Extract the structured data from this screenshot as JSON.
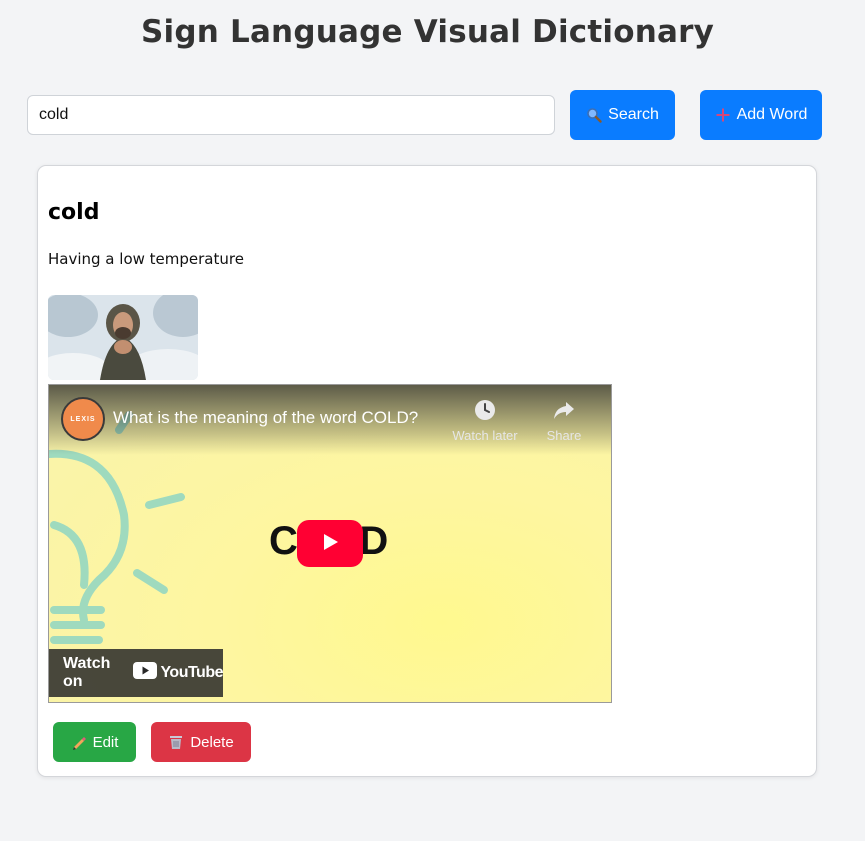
{
  "header": {
    "title": "Sign Language Visual Dictionary"
  },
  "search": {
    "value": "cold",
    "search_label": "Search",
    "add_label": "Add Word"
  },
  "entry": {
    "word": "cold",
    "definition": "Having a low temperature",
    "video": {
      "title": "What is the meaning of the word COLD?",
      "channel_avatar_text": "LEXIS",
      "watch_later_label": "Watch later",
      "share_label": "Share",
      "watch_on_label": "Watch on",
      "youtube_label": "YouTube",
      "overlay_text": "COLD"
    },
    "edit_label": "Edit",
    "delete_label": "Delete"
  },
  "colors": {
    "primary": "#0a7cff",
    "success": "#28a745",
    "danger": "#dc3545",
    "youtube_red": "#ff0033"
  },
  "icons": {
    "search": "magnifier-icon",
    "add": "plus-icon",
    "edit": "pencil-icon",
    "delete": "trash-icon",
    "watch_later": "clock-icon",
    "share": "share-arrow-icon",
    "play": "play-icon"
  }
}
